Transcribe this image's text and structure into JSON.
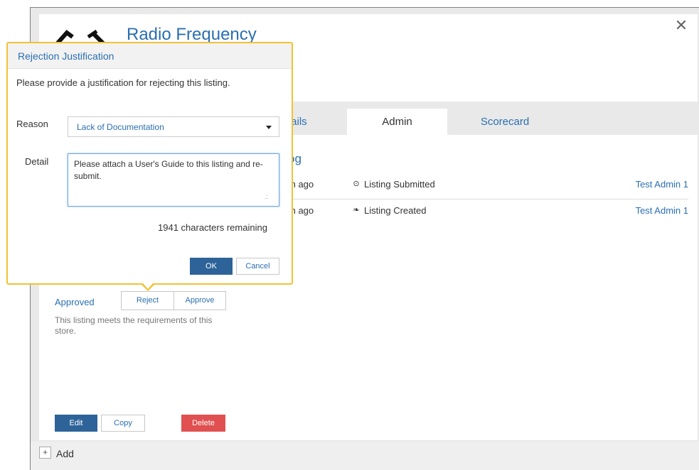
{
  "listing": {
    "title": "Radio Frequency"
  },
  "tabs": [
    {
      "label": "tails"
    },
    {
      "label": "Admin"
    },
    {
      "label": "Scorecard"
    }
  ],
  "changelog": {
    "title": "og",
    "rows": [
      {
        "when": "th ago",
        "icon": "clock-icon",
        "action": "Listing Submitted",
        "by": "Test Admin 1"
      },
      {
        "when": "th ago",
        "icon": "leaf-icon",
        "action": "Listing Created",
        "by": "Test Admin 1"
      }
    ]
  },
  "status": {
    "label": "Approved",
    "reject_label": "Reject",
    "approve_label": "Approve",
    "description": "This listing meets the requirements of this store."
  },
  "actions": {
    "edit": "Edit",
    "copy": "Copy",
    "delete": "Delete"
  },
  "footer": {
    "add_icon": "+",
    "add_label": "Add"
  },
  "popover": {
    "title": "Rejection Justification",
    "instruction": "Please provide a justification for rejecting this listing.",
    "reason_label": "Reason",
    "reason_value": "Lack of Documentation",
    "detail_label": "Detail",
    "detail_value": "Please attach a User's Guide to this listing and re-submit.",
    "remaining": "1941 characters remaining",
    "ok_label": "OK",
    "cancel_label": "Cancel"
  },
  "colors": {
    "accent": "#2a6fb0",
    "primary_button": "#2d6398",
    "danger_button": "#e05050",
    "highlight_border": "#f1c232"
  }
}
